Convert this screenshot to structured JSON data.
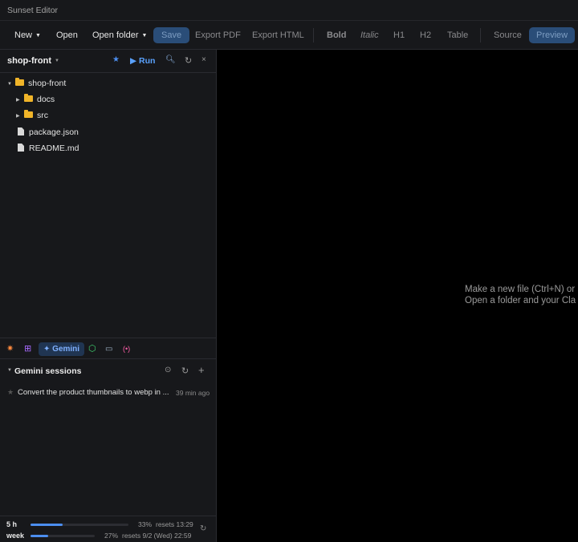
{
  "window": {
    "title": "Sunset Editor"
  },
  "toolbar": {
    "new": "New",
    "open": "Open",
    "open_folder": "Open folder",
    "save": "Save",
    "export_pdf": "Export PDF",
    "export_html": "Export HTML",
    "bold": "Bold",
    "italic": "Italic",
    "h1": "H1",
    "h2": "H2",
    "table": "Table",
    "source": "Source",
    "preview": "Preview"
  },
  "project": {
    "name": "shop-front",
    "run_label": "Run"
  },
  "tree": {
    "root": "shop-front",
    "items": [
      {
        "label": "docs",
        "kind": "folder"
      },
      {
        "label": "src",
        "kind": "folder"
      },
      {
        "label": "package.json",
        "kind": "file"
      },
      {
        "label": "README.md",
        "kind": "file"
      }
    ]
  },
  "agents": {
    "active": "Gemini"
  },
  "sessions": {
    "title": "Gemini sessions",
    "items": [
      {
        "text": "Convert the product thumbnails to webp in ...",
        "time": "39 min ago"
      }
    ]
  },
  "usage": {
    "rows": [
      {
        "label": "5 h",
        "percent": 33,
        "percent_text": "33%",
        "reset": "resets 13:29"
      },
      {
        "label": "week",
        "percent": 27,
        "percent_text": "27%",
        "reset": "resets 9/2 (Wed) 22:59"
      }
    ]
  },
  "editor": {
    "empty_line1": "Make a new file (Ctrl+N) or",
    "empty_line2": "Open a folder and your Cla"
  }
}
